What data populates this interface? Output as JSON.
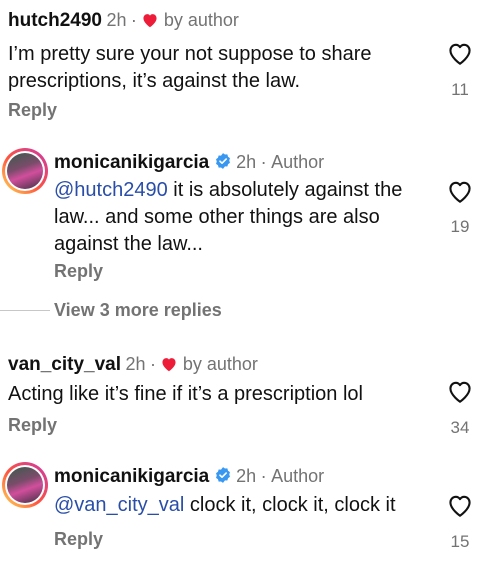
{
  "comments": [
    {
      "username": "hutch2490",
      "time": "2h",
      "separator": "·",
      "liked_by_author": "by author",
      "text": "I’m pretty sure your not suppose to share prescriptions, it’s against the law.",
      "reply_label": "Reply",
      "like_count": "11"
    },
    {
      "username": "monicanikigarcia",
      "time": "2h",
      "separator": "·",
      "author_label": "Author",
      "mention": "@hutch2490",
      "text": " it is absolutely against the law... and some other things are also against the law...",
      "reply_label": "Reply",
      "like_count": "19",
      "view_replies": "View 3 more replies"
    },
    {
      "username": "van_city_val",
      "time": "2h",
      "separator": "·",
      "liked_by_author": "by author",
      "text": "Acting like it’s fine if it’s a prescription lol",
      "reply_label": "Reply",
      "like_count": "34"
    },
    {
      "username": "monicanikigarcia",
      "time": "2h",
      "separator": "·",
      "author_label": "Author",
      "mention": "@van_city_val",
      "text": " clock it, clock it, clock it",
      "reply_label": "Reply",
      "like_count": "15"
    }
  ],
  "colors": {
    "mention": "#2a4ea8",
    "heart_red": "#ed1c38",
    "verified_blue": "#3897f0",
    "muted": "#737373"
  },
  "icons": {
    "like": "heart-outline-icon",
    "liked_by_author": "heart-filled-icon",
    "verified": "verified-badge-icon"
  }
}
